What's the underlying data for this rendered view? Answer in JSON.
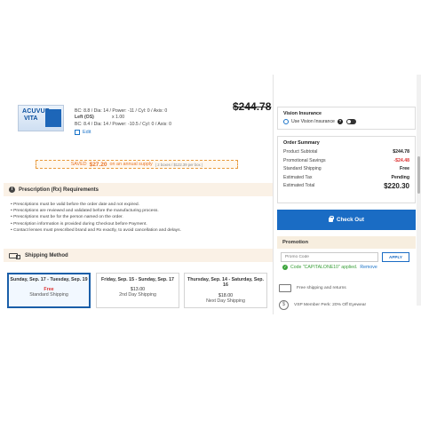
{
  "product": {
    "brand_line1": "ACUVUE",
    "brand_line2": "VITA",
    "price_original": "$244.78",
    "right_eye": "BC: 8.8 / Dia: 14 / Power: -11 / Cyl: 0 / Axis: 0",
    "left_eye_label": "Left (OS)",
    "left_eye_qty": "x 1.00",
    "left_eye": "BC: 8.4 / Dia: 14 / Power: -10.5 / Cyl: 0 / Axis: 0",
    "edit_label": "Edit"
  },
  "savings": {
    "label": "SAVED",
    "amount": "$27.20",
    "text": "on an annual supply",
    "detail": "( 2 boxes / $122.39 per box )"
  },
  "prescription": {
    "title": "Prescription (Rx) Requirements",
    "items": [
      "Prescriptions must be valid before the order date and not expired.",
      "Prescriptions are reviewed and validated before the manufacturing process.",
      "Prescriptions must be for the person named on the order.",
      "Prescription information is provided during Checkout before Payment.",
      "Contact lenses must prescribed brand and Rx exactly, to avoid cancellation and delays."
    ]
  },
  "shipping": {
    "title": "Shipping Method",
    "options": [
      {
        "date": "Sunday, Sep. 17 - Tuesday, Sep. 19",
        "price": "Free",
        "method": "Standard Shipping",
        "selected": true
      },
      {
        "date": "Friday, Sep. 15 - Sunday, Sep. 17",
        "price": "$13.00",
        "method": "2nd Day Shipping",
        "selected": false
      },
      {
        "date": "Thursday, Sep. 14 - Saturday, Sep. 16",
        "price": "$18.00",
        "method": "Next Day Shipping",
        "selected": false
      }
    ]
  },
  "vision_insurance": {
    "title": "Vision Insurance",
    "option_label": "Use Vision Insurance",
    "help_icon": "?"
  },
  "order_summary": {
    "title": "Order Summary",
    "rows": [
      {
        "label": "Product Subtotal",
        "value": "$244.78"
      },
      {
        "label": "Promotional Savings",
        "value": "-$24.48"
      },
      {
        "label": "Standard Shipping",
        "value": "Free"
      },
      {
        "label": "Estimated Tax",
        "value": "Pending"
      },
      {
        "label": "Estimated Total",
        "value": "$220.30"
      }
    ]
  },
  "checkout": {
    "label": "Check Out"
  },
  "promotion": {
    "title": "Promotion",
    "placeholder": "Promo Code",
    "apply_label": "APPLY",
    "applied_text": "Code \"CAPITALONE10\" applied.",
    "remove_label": "Remove"
  },
  "perks": {
    "shipping": "Free shipping and returns",
    "vsp": "VSP Member Perk: 20% Off Eyewear",
    "vsp_icon": "$"
  },
  "colors": {
    "accent": "#1a6cc4",
    "savings": "#e8772b",
    "negative": "#d33333",
    "success": "#3aa33a",
    "section_bg": "#faf1e6"
  }
}
